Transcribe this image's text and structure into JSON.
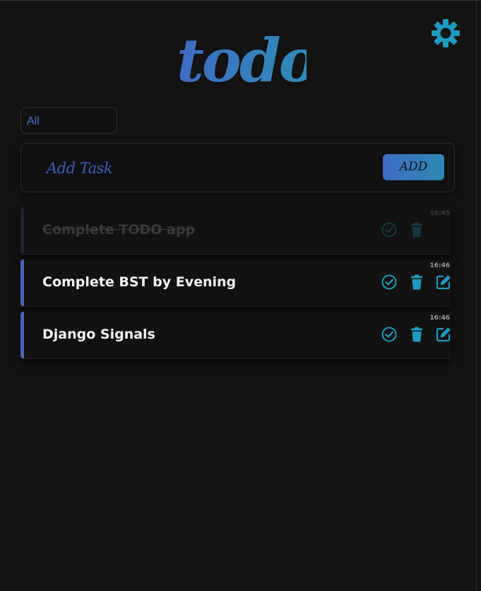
{
  "app": {
    "logo_text": "todo"
  },
  "colors": {
    "accent_teal": "#1c9cc0",
    "accent_blue": "#3f6cc4",
    "background": "#131313"
  },
  "header": {
    "settings_icon": "gear-icon"
  },
  "filter": {
    "value": "All"
  },
  "add_task": {
    "placeholder": "Add Task",
    "button_label": "ADD"
  },
  "tasks": [
    {
      "title": "Complete TODO app",
      "time": "16:45",
      "completed": true
    },
    {
      "title": "Complete BST by Evening",
      "time": "16:46",
      "completed": false
    },
    {
      "title": "Django Signals",
      "time": "16:46",
      "completed": false
    }
  ],
  "icons": {
    "complete": "check-circle-icon",
    "delete": "trash-icon",
    "edit": "edit-icon"
  }
}
